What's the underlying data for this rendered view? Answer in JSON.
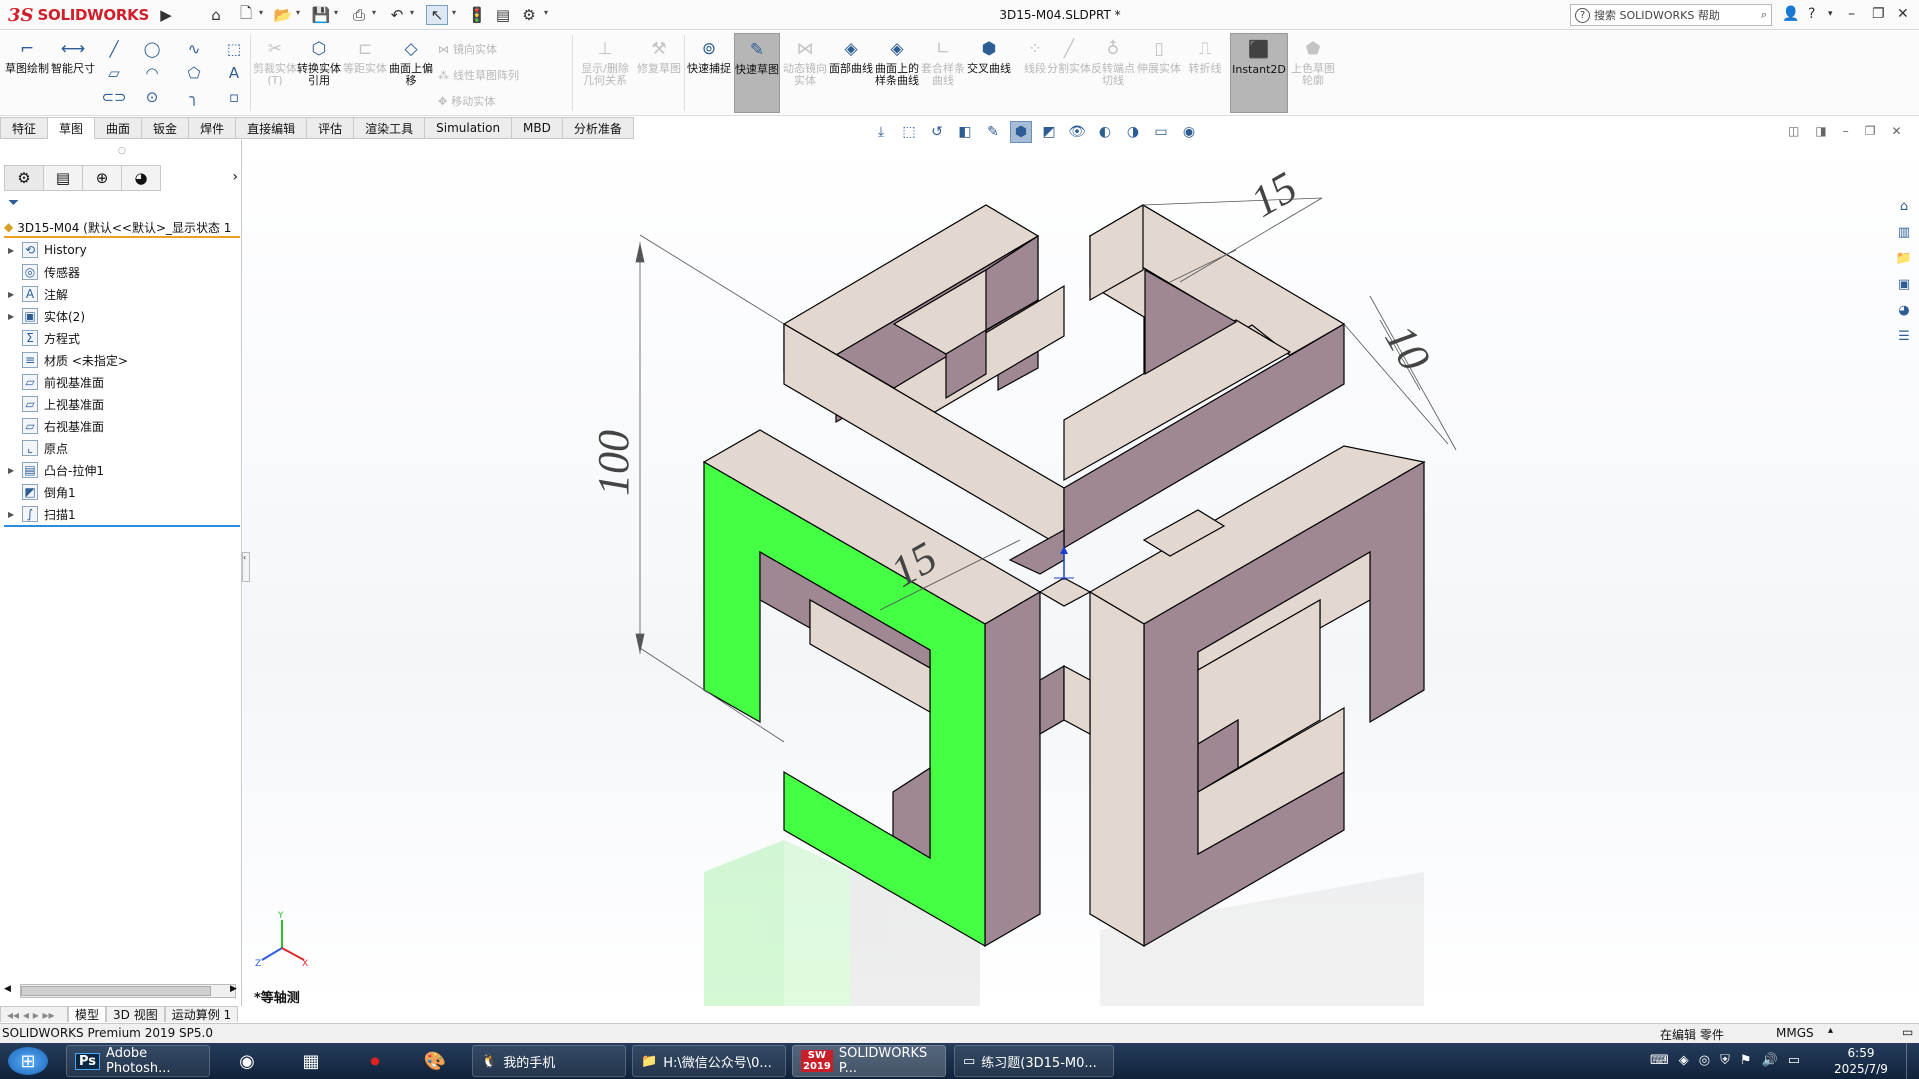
{
  "app": {
    "logo_ds": "3S",
    "logo_brand": "SOLIDWORKS",
    "doc_title": "3D15-M04.SLDPRT *",
    "help_search_placeholder": "搜索 SOLIDWORKS 帮助"
  },
  "commands": {
    "sketch": "草图绘制",
    "smart_dim": "智能尺寸",
    "trim": "剪裁实体(T)",
    "convert": "转换实体引用",
    "offset_ent": "等距实体",
    "offset_surface": "曲面上偏移",
    "mirror": "镜向实体",
    "linear_pattern": "线性草图阵列",
    "move": "移动实体",
    "show_relations": "显示/删除几何关系",
    "repair": "修复草图",
    "quick_snaps": "快速捕捉",
    "rapid_sketch": "快速草图",
    "dynamic_mirror": "动态镜向实体",
    "face_curves": "面部曲线",
    "spline_on_surface": "曲面上的样条曲线",
    "fit_spline": "套合样条曲线",
    "intersection": "交叉曲线",
    "segment": "线段",
    "split": "分割实体",
    "reverse_tangency": "反转端点切线",
    "stretch": "伸展实体",
    "jog": "转折线",
    "instant2d": "Instant2D",
    "shaded_contour": "上色草图轮廓"
  },
  "tabs": [
    "特征",
    "草图",
    "曲面",
    "钣金",
    "焊件",
    "直接编辑",
    "评估",
    "渲染工具",
    "Simulation",
    "MBD",
    "分析准备"
  ],
  "active_tab": "草图",
  "tree": {
    "root": "3D15-M04  (默认<<默认>_显示状态 1",
    "items": [
      "History",
      "传感器",
      "注解",
      "实体(2)",
      "方程式",
      "材质 <未指定>",
      "前视基准面",
      "上视基准面",
      "右视基准面",
      "原点",
      "凸台-拉伸1",
      "倒角1",
      "扫描1"
    ]
  },
  "model_tabs": [
    "模型",
    "3D 视图",
    "运动算例 1"
  ],
  "view": {
    "orientation_label": "*等轴测",
    "dims": [
      "15",
      "10",
      "100",
      "15"
    ]
  },
  "status": {
    "left": "SOLIDWORKS Premium 2019 SP5.0",
    "editing": "在编辑 零件",
    "units": "MMGS"
  },
  "taskbar": {
    "items": [
      "Adobe Photosh...",
      "我的手机",
      "H:\\微信公众号\\0...",
      "SOLIDWORKS P...",
      "练习题(3D15-M0..."
    ],
    "sw_badge": "2019",
    "time": "6:59",
    "date": "2025/7/9"
  },
  "colors": {
    "highlight_face": "#44ff44",
    "light_face": "#e3d8d0",
    "dark_face": "#9f8893",
    "accent": "#2d5d94"
  }
}
